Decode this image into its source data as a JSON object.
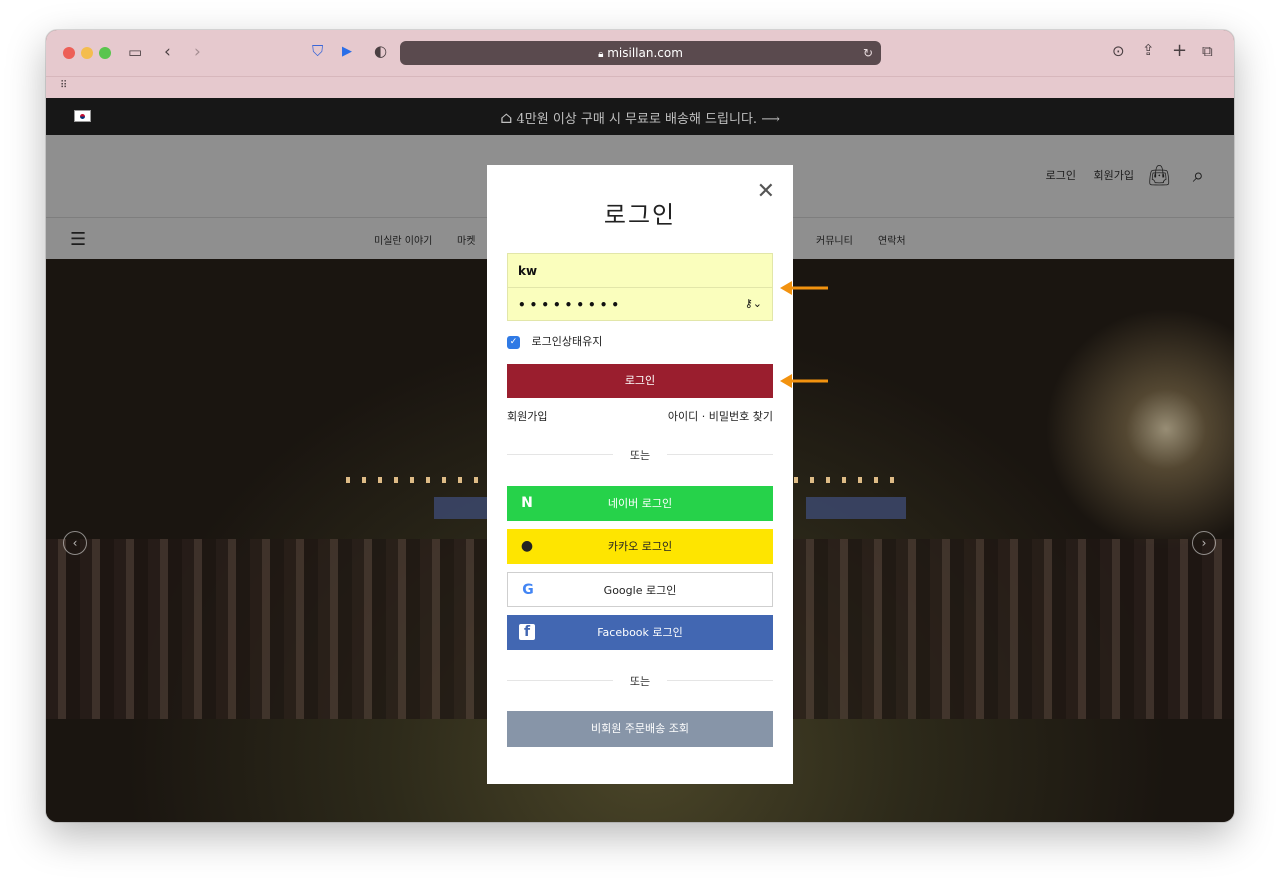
{
  "browser": {
    "url": "misillan.com"
  },
  "site": {
    "promo": "4만원 이상 구매 시 무료로 배송해 드립니다.",
    "header_links": [
      "로그인",
      "회원가입"
    ],
    "nav_items": [
      "미실란 이야기",
      "마켓",
      "커뮤니티",
      "연락처"
    ]
  },
  "modal": {
    "title": "로그인",
    "username_value": "kw",
    "password_mask": "•••••••••",
    "remember_label": "로그인상태유지",
    "login_button": "로그인",
    "signup_link": "회원가입",
    "find_link": "아이디 · 비밀번호 찾기",
    "or_label": "또는",
    "social": {
      "naver": "네이버 로그인",
      "kakao": "카카오 로그인",
      "google": "Google 로그인",
      "facebook": "Facebook 로그인"
    },
    "guest_button": "비회원 주문배송 조회"
  },
  "colors": {
    "login": "#9a1e2e",
    "naver": "#26d24a",
    "kakao": "#fee500",
    "facebook": "#4267b2",
    "guest": "#8795a8",
    "annotation_arrow": "#f2920f"
  }
}
